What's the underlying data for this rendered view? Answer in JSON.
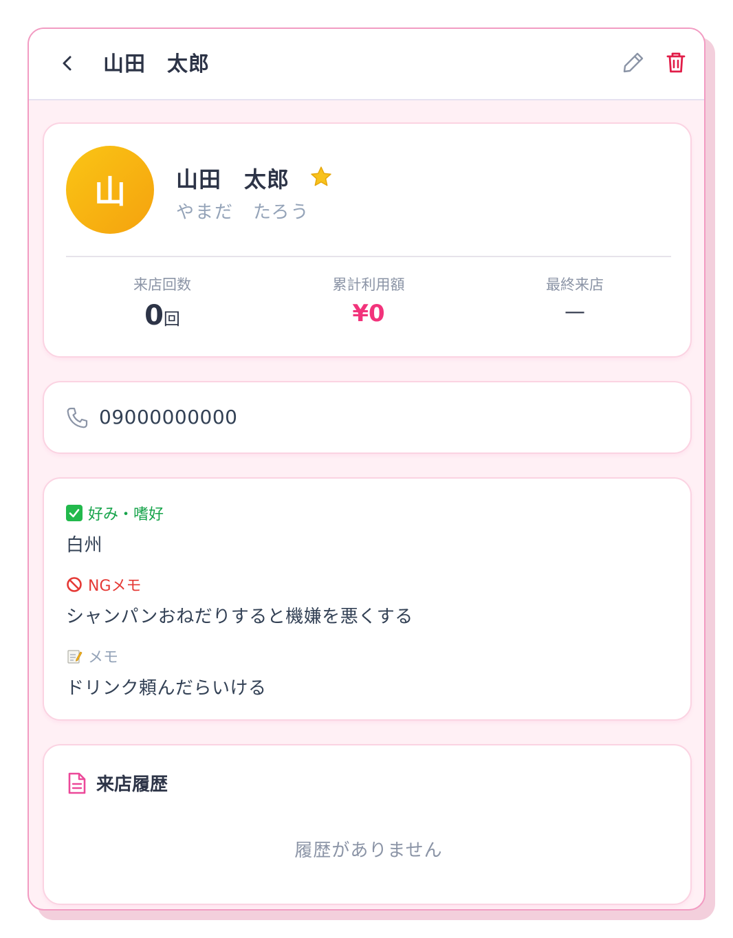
{
  "header": {
    "title": "山田　太郎"
  },
  "profile": {
    "avatar_initial": "山",
    "name": "山田　太郎",
    "kana": "やまだ　たろう",
    "stats": {
      "visits_label": "来店回数",
      "visits_value": "0",
      "visits_unit": "回",
      "total_label": "累計利用額",
      "total_value": "¥0",
      "last_label": "最終来店",
      "last_value": "—"
    }
  },
  "contact": {
    "phone": "09000000000"
  },
  "memo": {
    "preference_label": "好み・嗜好",
    "preference_text": "白州",
    "ng_label": "NGメモ",
    "ng_text": "シャンパンおねだりすると機嫌を悪くする",
    "note_label": "メモ",
    "note_text": "ドリンク頼んだらいける"
  },
  "history": {
    "title": "来店履歴",
    "empty_text": "履歴がありません"
  },
  "colors": {
    "accent": "#f2337b",
    "border": "#f29bc2",
    "background": "#fff0f5",
    "avatar_start": "#fac515",
    "avatar_end": "#f5a20e",
    "preference": "#16a34a",
    "ng": "#e53935",
    "delete": "#e11d48"
  }
}
